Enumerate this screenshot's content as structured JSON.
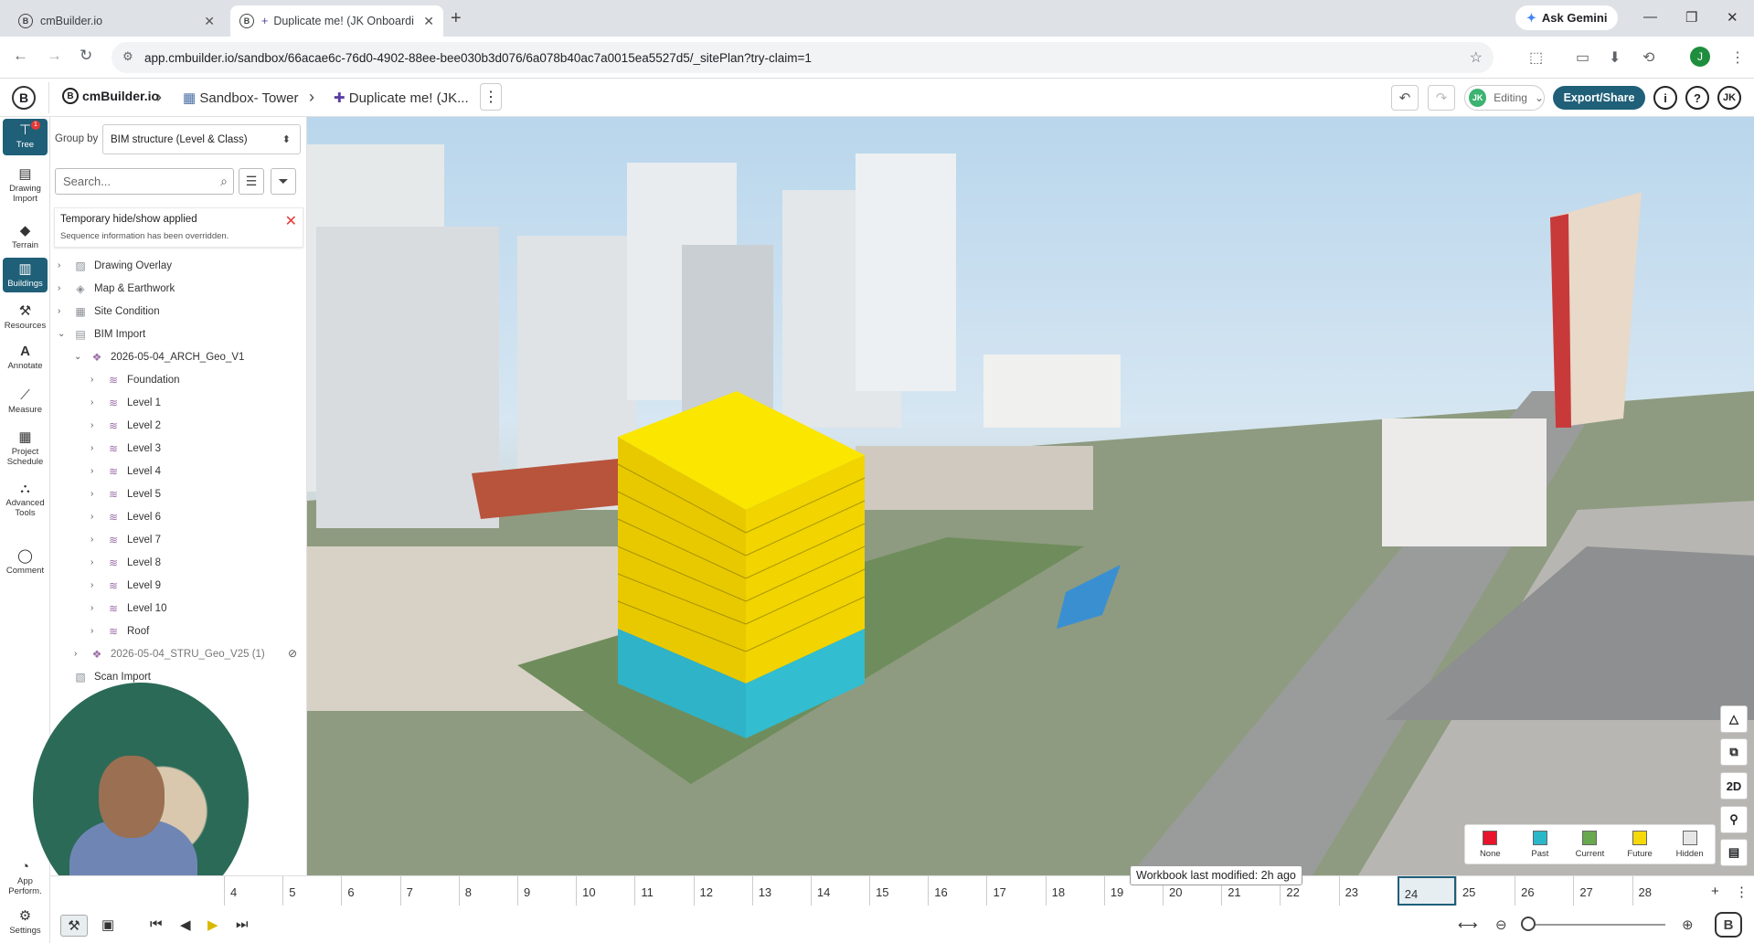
{
  "browser": {
    "tabs": [
      {
        "title": "cmBuilder.io"
      },
      {
        "title": "Duplicate me! (JK Onboardi"
      }
    ],
    "gemini": "Ask Gemini",
    "url": "app.cmbuilder.io/sandbox/66acae6c-76d0-4902-88ee-bee030b3d076/6a078b40ac7a0015ea5527d5/_sitePlan?try-claim=1",
    "profile": "J"
  },
  "app": {
    "brand": "cmBuilder.io",
    "breadcrumb": [
      "Sandbox- Tower",
      "Duplicate me! (JK..."
    ],
    "editing": "Editing",
    "editing_avatar": "JK",
    "export": "Export/Share",
    "user": "JK"
  },
  "rail": [
    {
      "label": "Tree",
      "icon": "tree-icon",
      "badge": "1"
    },
    {
      "label": "Drawing Import",
      "icon": "drawing-icon"
    },
    {
      "label": "Terrain",
      "icon": "terrain-icon"
    },
    {
      "label": "Buildings",
      "icon": "buildings-icon"
    },
    {
      "label": "Resources",
      "icon": "resources-icon"
    },
    {
      "label": "Annotate",
      "icon": "annotate-icon"
    },
    {
      "label": "Measure",
      "icon": "measure-icon"
    },
    {
      "label": "Project Schedule",
      "icon": "schedule-icon"
    },
    {
      "label": "Advanced Tools",
      "icon": "advanced-tools-icon"
    },
    {
      "label": "Comment",
      "icon": "comment-icon"
    },
    {
      "label": "App Perform.",
      "icon": "performance-icon"
    },
    {
      "label": "Settings",
      "icon": "settings-icon"
    }
  ],
  "panel": {
    "group_label": "Group by",
    "group_value": "BIM structure (Level & Class)",
    "search_placeholder": "Search...",
    "notice_title": "Temporary hide/show applied",
    "notice_sub": "Sequence information has been overridden.",
    "tree": [
      "Drawing Overlay",
      "Map & Earthwork",
      "Site Condition",
      "BIM Import",
      "2026-05-04_ARCH_Geo_V1",
      "Foundation",
      "Level 1",
      "Level 2",
      "Level 3",
      "Level 4",
      "Level 5",
      "Level 6",
      "Level 7",
      "Level 8",
      "Level 9",
      "Level 10",
      "Roof",
      "2026-05-04_STRU_Geo_V25 (1)",
      "Scan Import"
    ]
  },
  "timeline": {
    "ticks": [
      "4",
      "5",
      "6",
      "7",
      "8",
      "9",
      "10",
      "11",
      "12",
      "13",
      "14",
      "15",
      "16",
      "17",
      "18",
      "19",
      "20",
      "21",
      "22",
      "23",
      "24",
      "25",
      "26",
      "27",
      "28"
    ],
    "selected": "24",
    "workbook": "Workbook last modified: 2h ago"
  },
  "legend": [
    {
      "label": "None",
      "color": "#e8132c"
    },
    {
      "label": "Past",
      "color": "#2ab7c9"
    },
    {
      "label": "Current",
      "color": "#6aa84f"
    },
    {
      "label": "Future",
      "color": "#f5d90a"
    },
    {
      "label": "Hidden",
      "color": "#e6e6e6"
    }
  ],
  "view_tools": {
    "mode_2d": "2D"
  }
}
